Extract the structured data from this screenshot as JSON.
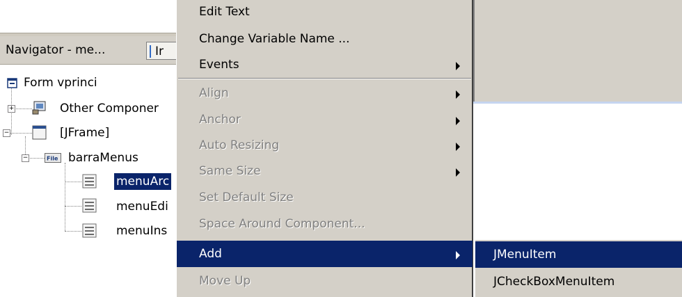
{
  "navigator": {
    "tab_active": "Navigator - me...",
    "tab_second": "Ir",
    "tree": {
      "form": "Form vprinci",
      "other": "Other Componer",
      "frame": "[JFrame]",
      "menubar": "barraMenus",
      "menubar_icon_text": "File",
      "items": [
        "menuArc",
        "menuEdi",
        "menuIns"
      ]
    }
  },
  "context_menu": {
    "items": [
      {
        "label": "Edit Text",
        "enabled": true,
        "submenu": false
      },
      {
        "label": "Change Variable Name ...",
        "enabled": true,
        "submenu": false
      },
      {
        "label": "Events",
        "enabled": true,
        "submenu": true
      },
      {
        "label": "Align",
        "enabled": false,
        "submenu": true
      },
      {
        "label": "Anchor",
        "enabled": false,
        "submenu": true
      },
      {
        "label": "Auto Resizing",
        "enabled": false,
        "submenu": true
      },
      {
        "label": "Same Size",
        "enabled": false,
        "submenu": true
      },
      {
        "label": "Set Default Size",
        "enabled": false,
        "submenu": false
      },
      {
        "label": "Space Around Component...",
        "enabled": false,
        "submenu": false
      },
      {
        "label": "Add",
        "enabled": true,
        "submenu": true,
        "highlighted": true
      },
      {
        "label": "Move Up",
        "enabled": false,
        "submenu": false
      }
    ]
  },
  "add_submenu": {
    "items": [
      {
        "label": "JMenuItem",
        "highlighted": true
      },
      {
        "label": "JCheckBoxMenuItem",
        "highlighted": false
      }
    ]
  },
  "colors": {
    "menu_bg": "#d4d0c8",
    "highlight": "#0a246a",
    "disabled_text": "#808080"
  }
}
